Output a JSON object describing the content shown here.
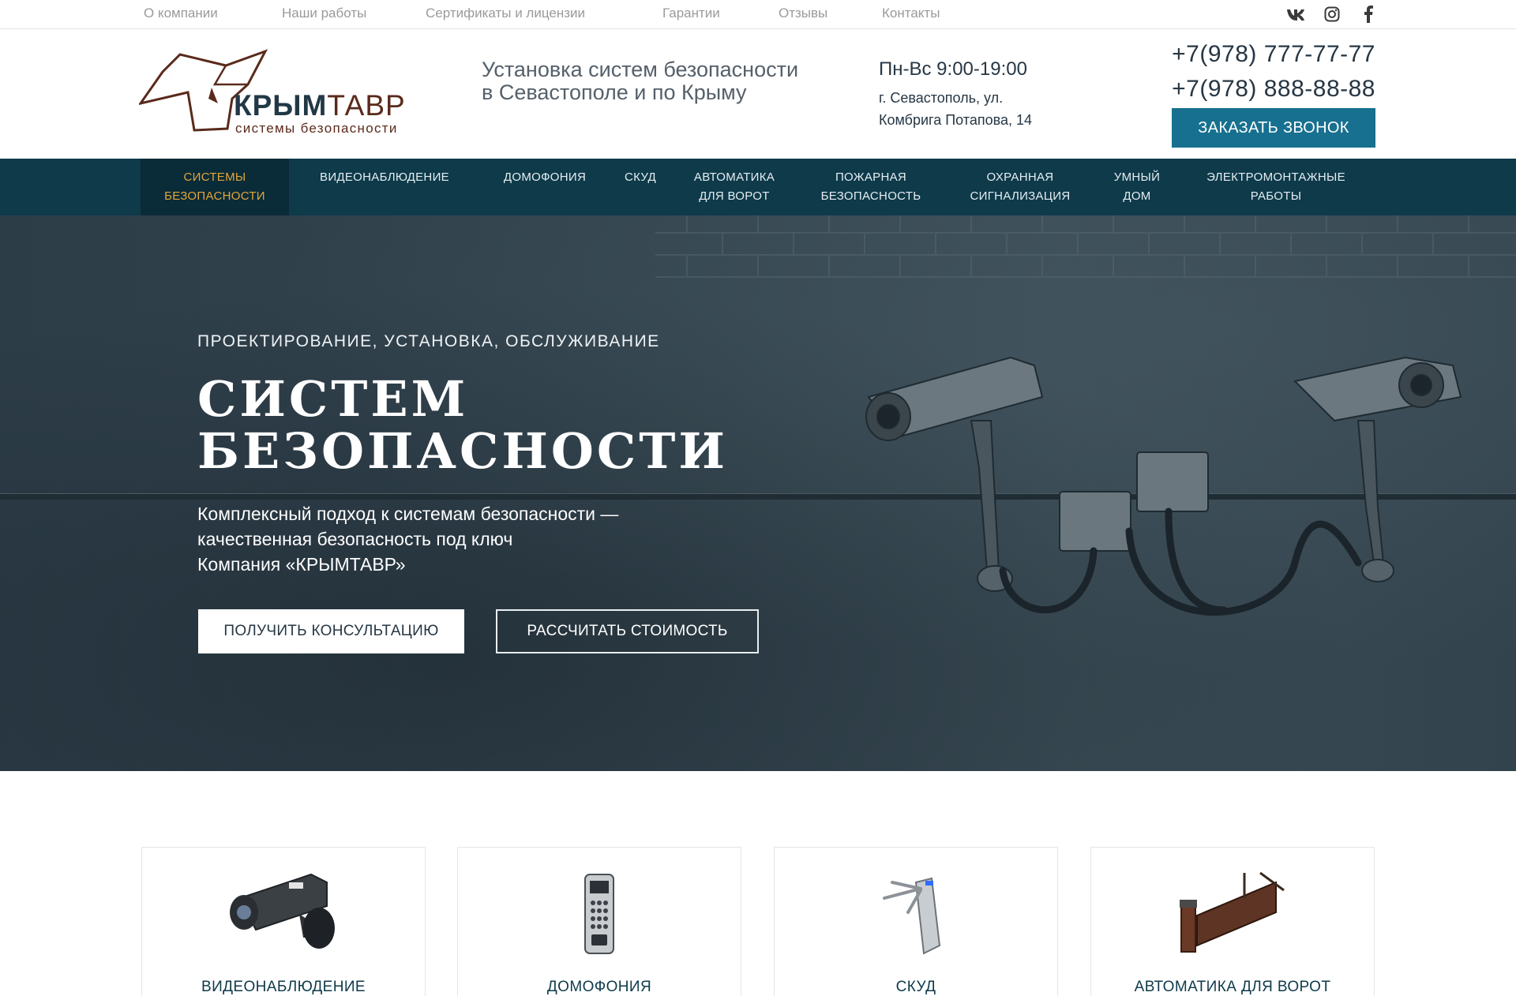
{
  "topnav": {
    "links": [
      "О компании",
      "Наши работы",
      "Сертификаты и лицензии",
      "Гарантии",
      "Отзывы",
      "Контакты"
    ]
  },
  "social": [
    "vk-icon",
    "instagram-icon",
    "facebook-icon"
  ],
  "header": {
    "logo_bold": "КРЫМ",
    "logo_light": "ТАВР",
    "logo_sub": "системы безопасности",
    "tagline": "Установка систем безопасности в Севастополе и по Крыму",
    "hours": "Пн-Вс 9:00-19:00",
    "address_line1": "г. Севастополь, ул.",
    "address_line2": "Комбрига Потапова, 14",
    "phone1": "+7(978) 777-77-77",
    "phone2": "+7(978) 888-88-88",
    "callback_label": "ЗАКАЗАТЬ ЗВОНОК"
  },
  "mainnav": {
    "items": [
      {
        "l1": "СИСТЕМЫ",
        "l2": "БЕЗОПАСНОСТИ"
      },
      {
        "l1": "ВИДЕОНАБЛЮДЕНИЕ",
        "l2": ""
      },
      {
        "l1": "ДОМОФОНИЯ",
        "l2": ""
      },
      {
        "l1": "СКУД",
        "l2": ""
      },
      {
        "l1": "АВТОМАТИКА",
        "l2": "ДЛЯ ВОРОТ"
      },
      {
        "l1": "ПОЖАРНАЯ",
        "l2": "БЕЗОПАСНОСТЬ"
      },
      {
        "l1": "ОХРАННАЯ",
        "l2": "СИГНАЛИЗАЦИЯ"
      },
      {
        "l1": "УМНЫЙ",
        "l2": "ДОМ"
      },
      {
        "l1": "ЭЛЕКТРОМОНТАЖНЫЕ",
        "l2": "РАБОТЫ"
      }
    ]
  },
  "hero": {
    "kicker": "ПРОЕКТИРОВАНИЕ, УСТАНОВКА, ОБСЛУЖИВАНИЕ",
    "title_line1": "СИСТЕМ",
    "title_line2": "БЕЗОПАСНОСТИ",
    "desc_line1": "Комплексный подход к системам безопасности —",
    "desc_line2": "качественная безопасность под ключ",
    "desc_line3": "Компания «КРЫМТАВР»",
    "btn_primary": "ПОЛУЧИТЬ КОНСУЛЬТАЦИЮ",
    "btn_secondary": "РАССЧИТАТЬ СТОИМОСТЬ"
  },
  "cards": [
    {
      "title": "ВИДЕОНАБЛЮДЕНИЕ",
      "icon": "cctv-camera-icon"
    },
    {
      "title": "ДОМОФОНИЯ",
      "icon": "intercom-panel-icon"
    },
    {
      "title": "СКУД",
      "icon": "turnstile-icon"
    },
    {
      "title": "АВТОМАТИКА ДЛЯ ВОРОТ",
      "icon": "sliding-gate-icon"
    }
  ],
  "colors": {
    "nav_bg": "#0e3a4a",
    "accent_button": "#17708f",
    "active_nav_text": "#e3a63a",
    "logo_brown": "#5a2a1c"
  }
}
